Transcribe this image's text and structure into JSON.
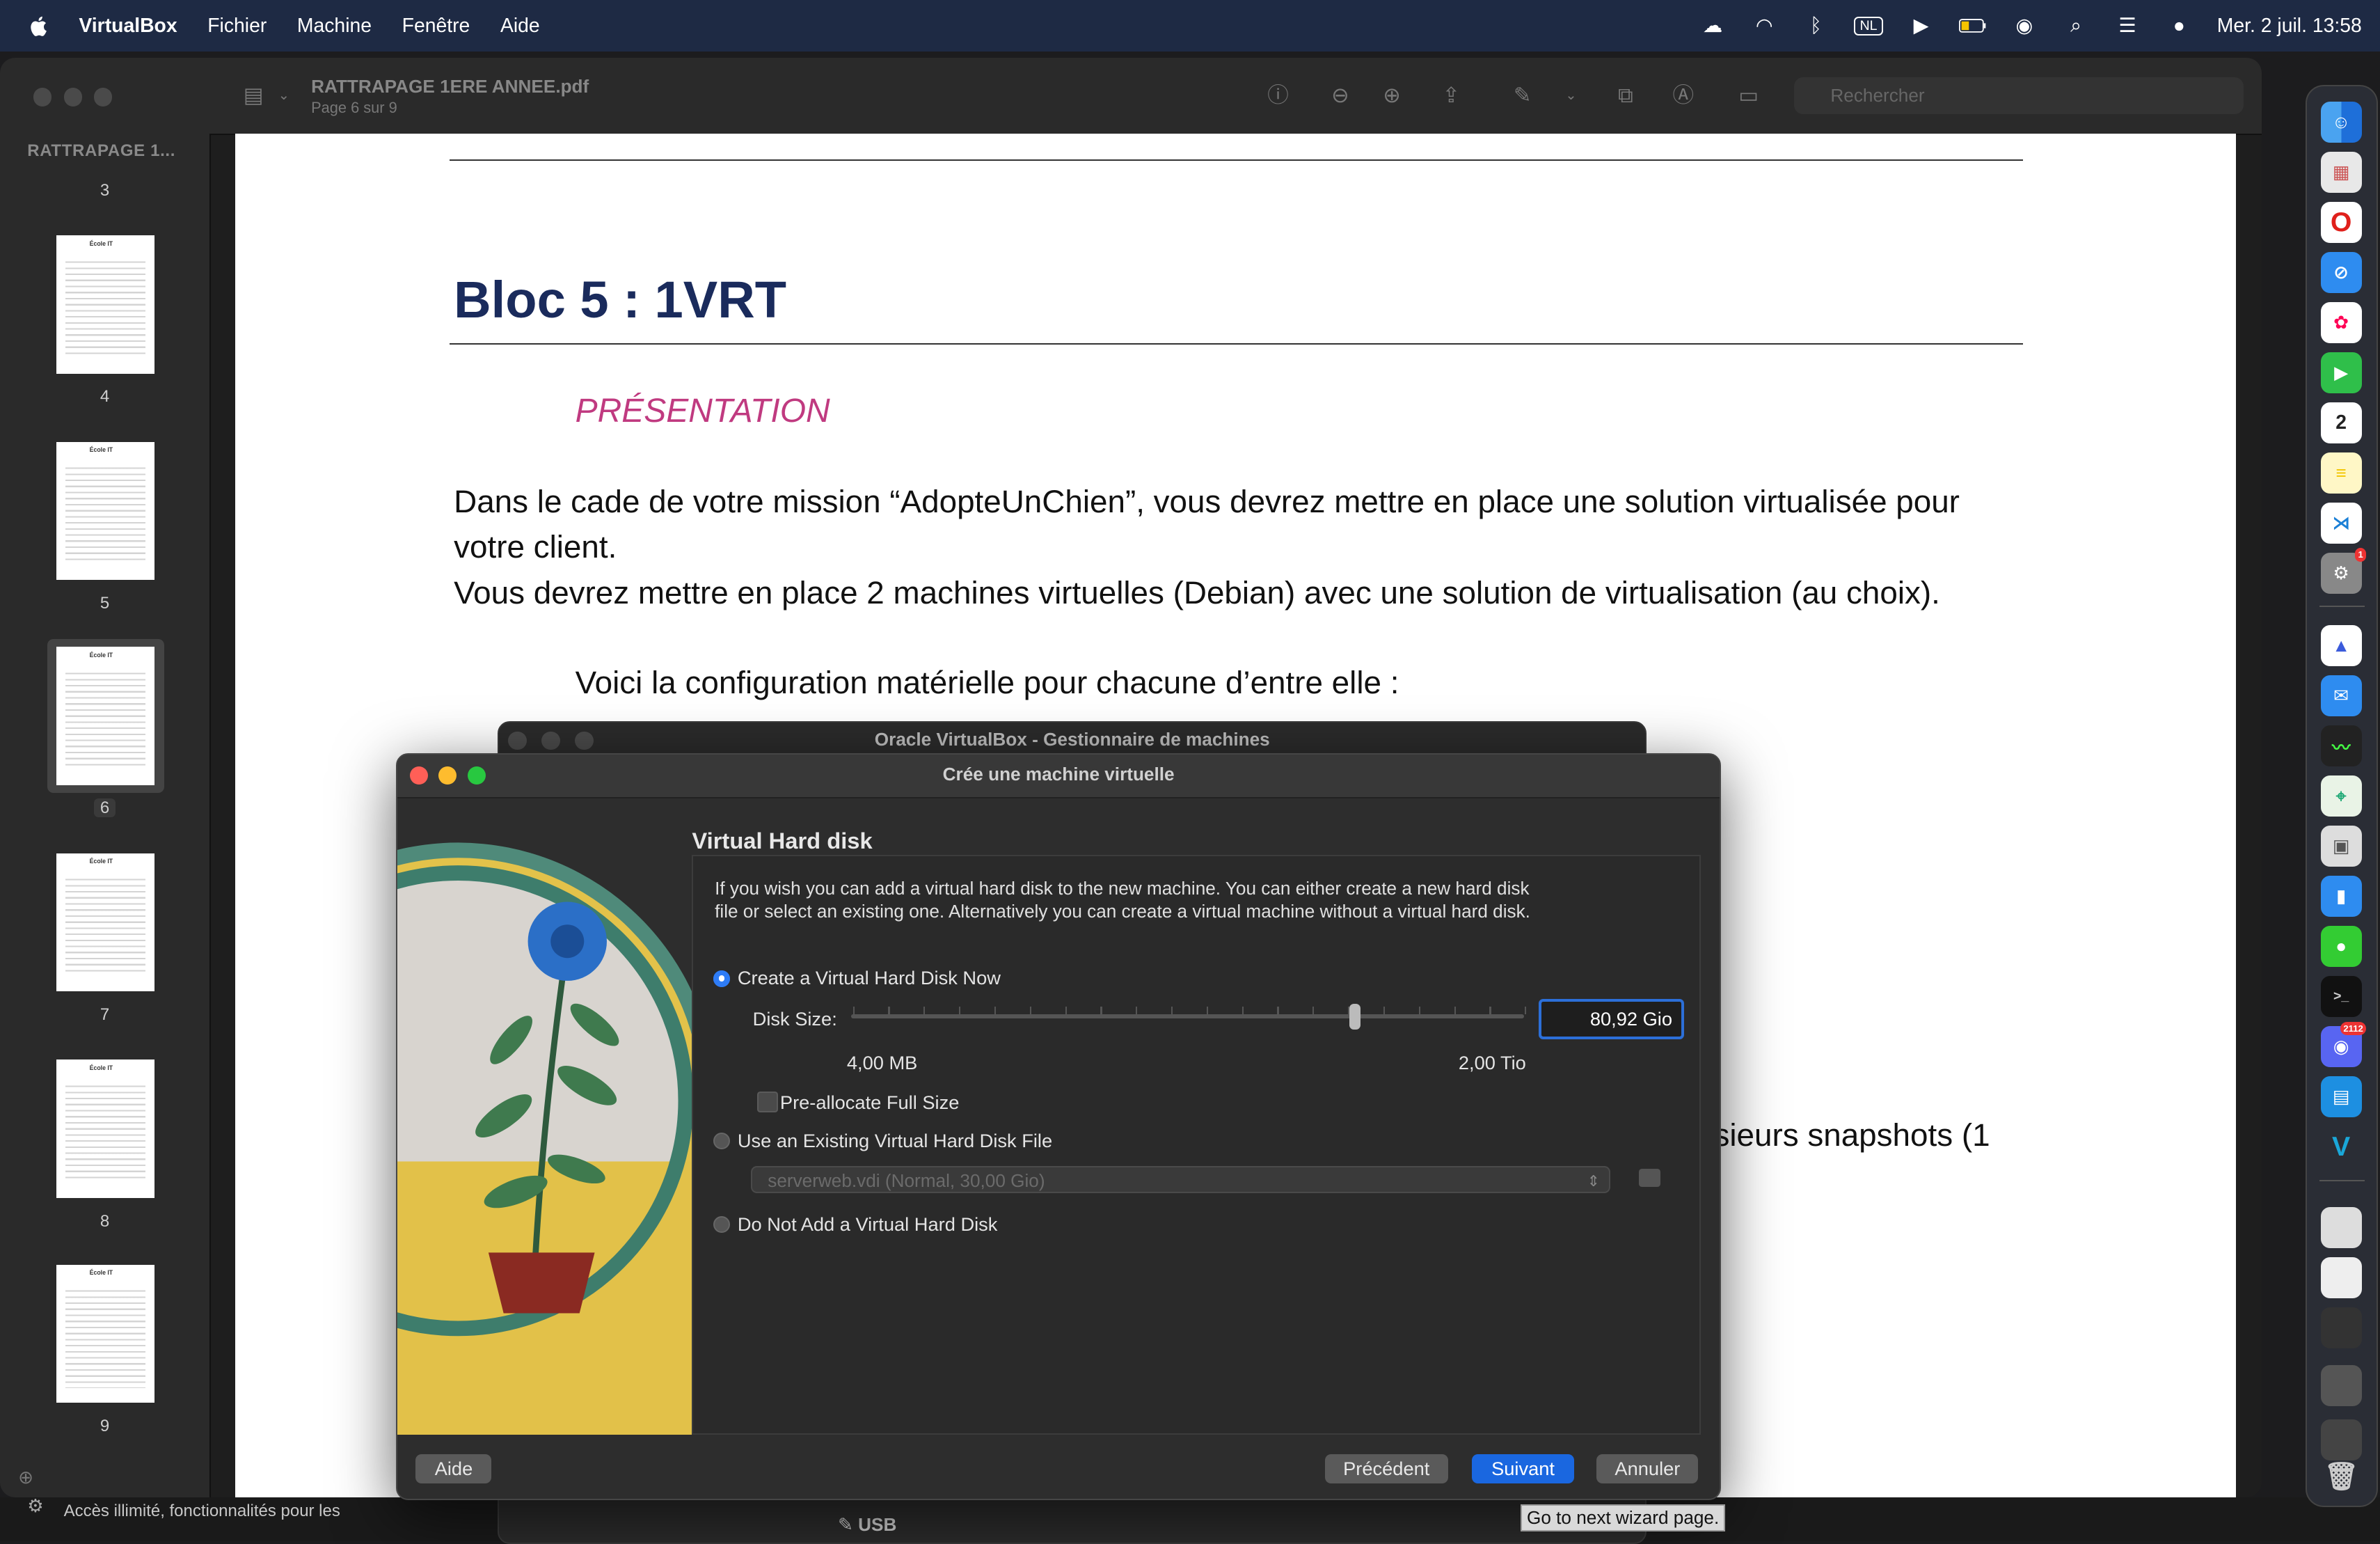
{
  "menubar": {
    "app_name": "VirtualBox",
    "items": [
      "Fichier",
      "Machine",
      "Fenêtre",
      "Aide"
    ],
    "keyboard_layout": "NL",
    "datetime": "Mer. 2 juil.  13:58"
  },
  "preview": {
    "doc_title": "RATTRAPAGE 1ERE ANNEE.pdf",
    "doc_subtitle": "Page 6 sur 9",
    "sidebar_title": "RATTRAPAGE 1...",
    "search_placeholder": "Rechercher",
    "pages": [
      "3",
      "4",
      "5",
      "6",
      "7",
      "8",
      "9"
    ],
    "selected_page": "6",
    "thumb_header": "École IT",
    "footer_text": "Accès illimité, fonctionnalités pour les"
  },
  "document": {
    "heading": "Bloc 5 : 1VRT",
    "subheading": "PRÉSENTATION",
    "para1": "Dans le cade de votre mission “AdopteUnChien”, vous devrez mettre en place une solution virtualisée pour votre client.",
    "para2": "Vous devrez mettre en place 2 machines virtuelles (Debian) avec une solution de virtualisation (au choix).",
    "para3": "Voici la configuration matérielle pour chacune d’entre elle :",
    "partial_line": "sieurs snapshots (1"
  },
  "manager": {
    "title": "Oracle VirtualBox - Gestionnaire de machines",
    "usb_label": "USB"
  },
  "dialog": {
    "title": "Crée une machine virtuelle",
    "section_title": "Virtual Hard disk",
    "description": "If you wish you can add a virtual hard disk to the new machine. You can either create a new hard disk file or select an existing one. Alternatively you can create a virtual machine without a virtual hard disk.",
    "option_create": "Create a Virtual Hard Disk Now",
    "disk_size_label": "Disk Size:",
    "disk_size_value": "80,92 Gio",
    "slider_position": 0.75,
    "min_label": "4,00 MB",
    "max_label": "2,00 Tio",
    "preallocate_label": "Pre-allocate Full Size",
    "option_existing": "Use an Existing Virtual Hard Disk File",
    "existing_file": "serverweb.vdi (Normal, 30,00 Gio)",
    "option_none": "Do Not Add a Virtual Hard Disk",
    "selected_option": "create",
    "buttons": {
      "help": "Aide",
      "previous": "Précédent",
      "next": "Suivant",
      "cancel": "Annuler"
    },
    "tooltip": "Go to next wizard page."
  },
  "dock": {
    "apps": [
      "finder",
      "launchpad",
      "opera",
      "safari",
      "photos",
      "facetime",
      "calendar",
      "notes",
      "vscode",
      "system-settings",
      "nordvpn",
      "mail",
      "activity-monitor",
      "maps",
      "preview",
      "keynote",
      "messages",
      "terminal",
      "discord",
      "docker",
      "virtualbox",
      "trash"
    ],
    "calendar_day": "2",
    "discord_badge": "2112",
    "settings_badge": "1"
  }
}
